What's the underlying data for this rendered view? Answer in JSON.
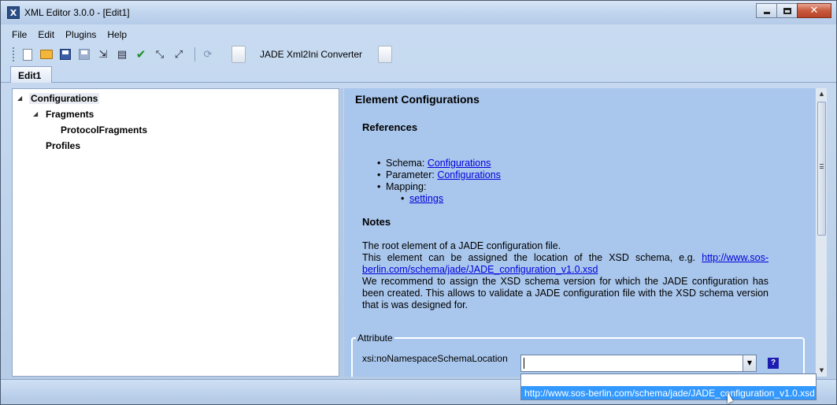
{
  "window": {
    "icon_letter": "X",
    "title": "XML Editor 3.0.0 - [Edit1]",
    "close_glyph": "✕"
  },
  "menu": [
    "File",
    "Edit",
    "Plugins",
    "Help"
  ],
  "toolbar": {
    "converter_label": "JADE Xml2Ini Converter",
    "icons": [
      "new-document-icon",
      "open-folder-icon",
      "save-icon",
      "save-all-icon",
      "import-icon",
      "preview-icon",
      "validate-icon",
      "expand-icon",
      "collapse-icon",
      "refresh-icon",
      "page-icon"
    ]
  },
  "tabs": [
    {
      "label": "Edit1"
    }
  ],
  "tree": {
    "nodes": [
      {
        "label": "Configurations",
        "expander": "◢",
        "selected": true
      },
      {
        "label": "Fragments",
        "expander": "◢"
      },
      {
        "label": "ProtocolFragments"
      },
      {
        "label": "Profiles"
      }
    ]
  },
  "detail": {
    "title": "Element Configurations",
    "references_heading": "References",
    "references": [
      {
        "prefix": "Schema:",
        "link": "Configurations"
      },
      {
        "prefix": "Parameter:",
        "link": "Configurations"
      },
      {
        "prefix": "Mapping:",
        "link": ""
      }
    ],
    "mapping_sub": "settings",
    "notes_heading": "Notes",
    "notes": {
      "line1": "The root element of a JADE configuration file.",
      "line2_pre": "This element can be assigned the location of the XSD schema, e.g. ",
      "line2_link": "http://www.sos-berlin.com/schema/jade/JADE_configuration_v1.0.xsd",
      "line3": "We recommend to assign the XSD schema version for which the JADE configuration has been created. This allows to validate a JADE configuration file with the XSD schema version that is was designed for."
    },
    "attribute": {
      "legend": "Attribute",
      "name": "xsi:noNamespaceSchemaLocation",
      "value": "",
      "help": "?"
    }
  },
  "dropdown": {
    "options": [
      "http://www.sos-berlin.com/schema/jade/JADE_configuration_v1.0.xsd"
    ],
    "highlighted_index": 0
  },
  "colors": {
    "detail_bg": "#a9c6ec",
    "link": "#0000dd",
    "selection": "#3399ff",
    "close_button": "#c85a3c"
  }
}
